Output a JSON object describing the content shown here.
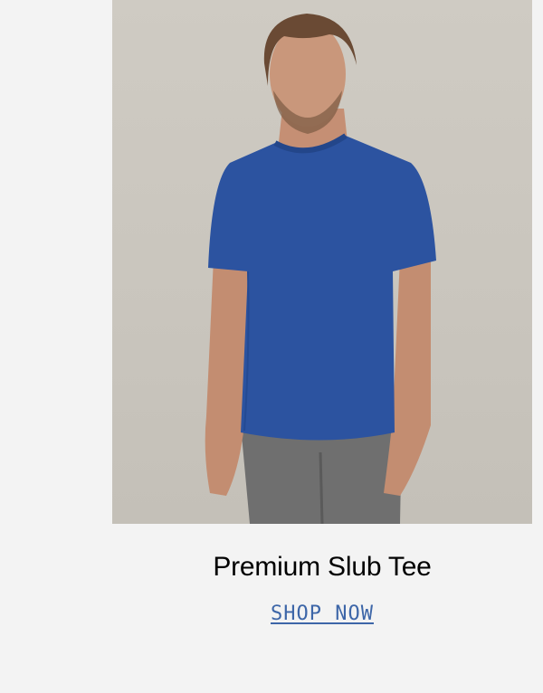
{
  "product": {
    "image_alt": "Model wearing blue t-shirt",
    "title": "Premium Slub Tee",
    "cta_label": "SHOP NOW"
  },
  "colors": {
    "page_background": "#f3f3f3",
    "shirt": "#2c53a0",
    "link": "#3d66a8"
  }
}
